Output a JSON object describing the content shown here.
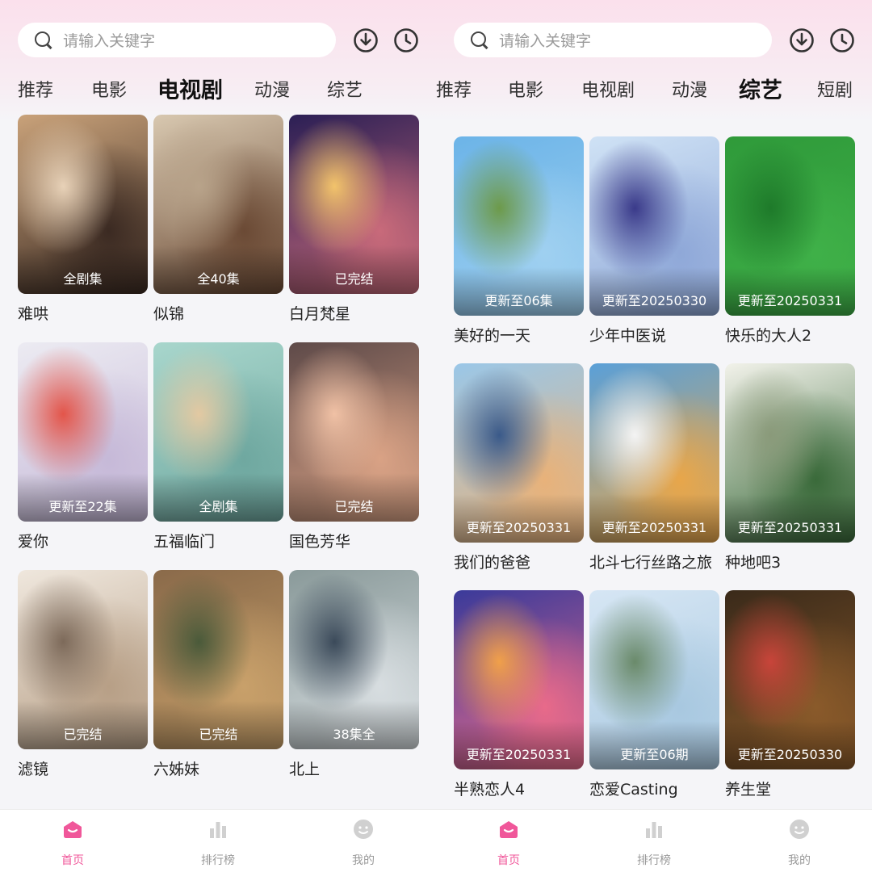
{
  "left": {
    "search_placeholder": "请输入关键字",
    "tabs": [
      {
        "label": "推荐",
        "active": false
      },
      {
        "label": "电影",
        "active": false
      },
      {
        "label": "电视剧",
        "active": true
      },
      {
        "label": "动漫",
        "active": false
      },
      {
        "label": "综艺",
        "active": false
      }
    ],
    "cards": [
      {
        "title": "难哄",
        "badge": "全剧集",
        "colors": [
          "#c9a27a",
          "#3b2a22",
          "#e8d2b8"
        ]
      },
      {
        "title": "似锦",
        "badge": "全40集",
        "colors": [
          "#d8c8b0",
          "#6b4a35",
          "#b8a38a"
        ]
      },
      {
        "title": "白月梵星",
        "badge": "已完结",
        "colors": [
          "#2b1f55",
          "#c86a7a",
          "#f2c36b"
        ]
      },
      {
        "title": "爱你",
        "badge": "更新至22集",
        "colors": [
          "#ecebf2",
          "#c6b9d8",
          "#e3554a"
        ]
      },
      {
        "title": "五福临门",
        "badge": "全剧集",
        "colors": [
          "#a8d6cc",
          "#6fa8a0",
          "#e3c9a2"
        ]
      },
      {
        "title": "国色芳华",
        "badge": "已完结",
        "colors": [
          "#5e4a49",
          "#d9a285",
          "#f0c1a5"
        ]
      },
      {
        "title": "滤镜",
        "badge": "已完结",
        "colors": [
          "#efe7dd",
          "#b79f86",
          "#7d6a5a"
        ]
      },
      {
        "title": "六姊妹",
        "badge": "已完结",
        "colors": [
          "#8a6a4a",
          "#c8a06a",
          "#4a5a3a"
        ]
      },
      {
        "title": "北上",
        "badge": "38集全",
        "colors": [
          "#8a9a9a",
          "#d7dde0",
          "#3b4a5a"
        ]
      }
    ]
  },
  "right": {
    "search_placeholder": "请输入关键字",
    "tabs": [
      {
        "label": "短剧推荐",
        "active": false
      },
      {
        "label": "电影",
        "active": false
      },
      {
        "label": "电视剧",
        "active": false
      },
      {
        "label": "动漫",
        "active": false
      },
      {
        "label": "综艺",
        "active": true
      },
      {
        "label": "短剧",
        "active": false
      }
    ],
    "cards": [
      {
        "title": "美好的一天",
        "badge": "更新至06集",
        "colors": [
          "#6cb4e8",
          "#9fd0f0",
          "#6d9a4a"
        ]
      },
      {
        "title": "少年中医说",
        "badge": "更新至20250330",
        "colors": [
          "#cfe2f5",
          "#8fa8d8",
          "#3a3a8a"
        ]
      },
      {
        "title": "快乐的大人2",
        "badge": "更新至20250331",
        "colors": [
          "#2f9a3a",
          "#3fb048",
          "#1e7a2a"
        ]
      },
      {
        "title": "我们的爸爸",
        "badge": "更新至20250331",
        "colors": [
          "#9ac7e8",
          "#e8b27a",
          "#3a5a8a"
        ]
      },
      {
        "title": "北斗七行丝路之旅",
        "badge": "更新至20250331",
        "colors": [
          "#5aa0d8",
          "#e8a64a",
          "#f4f4f4"
        ]
      },
      {
        "title": "种地吧3",
        "badge": "更新至20250331",
        "colors": [
          "#f2f2ea",
          "#3a6a3a",
          "#8a9a7a"
        ]
      },
      {
        "title": "半熟恋人4",
        "badge": "更新至20250331",
        "colors": [
          "#3a3a9a",
          "#e86a8a",
          "#f0a04a"
        ]
      },
      {
        "title": "恋爱Casting",
        "badge": "更新至06期",
        "colors": [
          "#d6e6f4",
          "#a8c8e0",
          "#6a8a6a"
        ]
      },
      {
        "title": "养生堂",
        "badge": "更新至20250330",
        "colors": [
          "#3a2a1a",
          "#8a5a2a",
          "#c8443a"
        ]
      }
    ]
  },
  "nav": [
    {
      "label": "首页",
      "icon": "home-icon",
      "active": true
    },
    {
      "label": "排行榜",
      "icon": "ranking-icon",
      "active": false
    },
    {
      "label": "我的",
      "icon": "profile-icon",
      "active": false
    }
  ],
  "accent": "#f0579a"
}
